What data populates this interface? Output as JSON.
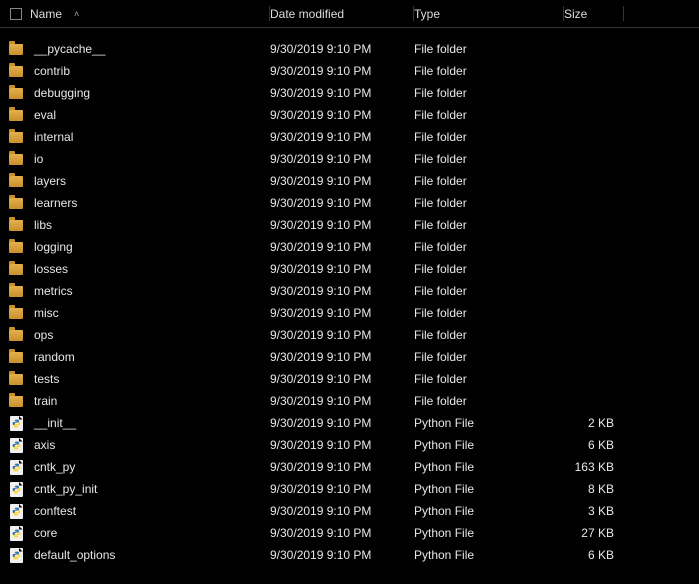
{
  "columns": {
    "name": "Name",
    "date": "Date modified",
    "type": "Type",
    "size": "Size"
  },
  "sort": {
    "column": "name",
    "direction": "asc"
  },
  "types": {
    "folder": "File folder",
    "python": "Python File"
  },
  "items": [
    {
      "name": "__pycache__",
      "date": "9/30/2019 9:10 PM",
      "kind": "folder",
      "size": ""
    },
    {
      "name": "contrib",
      "date": "9/30/2019 9:10 PM",
      "kind": "folder",
      "size": ""
    },
    {
      "name": "debugging",
      "date": "9/30/2019 9:10 PM",
      "kind": "folder",
      "size": ""
    },
    {
      "name": "eval",
      "date": "9/30/2019 9:10 PM",
      "kind": "folder",
      "size": ""
    },
    {
      "name": "internal",
      "date": "9/30/2019 9:10 PM",
      "kind": "folder",
      "size": ""
    },
    {
      "name": "io",
      "date": "9/30/2019 9:10 PM",
      "kind": "folder",
      "size": ""
    },
    {
      "name": "layers",
      "date": "9/30/2019 9:10 PM",
      "kind": "folder",
      "size": ""
    },
    {
      "name": "learners",
      "date": "9/30/2019 9:10 PM",
      "kind": "folder",
      "size": ""
    },
    {
      "name": "libs",
      "date": "9/30/2019 9:10 PM",
      "kind": "folder",
      "size": ""
    },
    {
      "name": "logging",
      "date": "9/30/2019 9:10 PM",
      "kind": "folder",
      "size": ""
    },
    {
      "name": "losses",
      "date": "9/30/2019 9:10 PM",
      "kind": "folder",
      "size": ""
    },
    {
      "name": "metrics",
      "date": "9/30/2019 9:10 PM",
      "kind": "folder",
      "size": ""
    },
    {
      "name": "misc",
      "date": "9/30/2019 9:10 PM",
      "kind": "folder",
      "size": ""
    },
    {
      "name": "ops",
      "date": "9/30/2019 9:10 PM",
      "kind": "folder",
      "size": ""
    },
    {
      "name": "random",
      "date": "9/30/2019 9:10 PM",
      "kind": "folder",
      "size": ""
    },
    {
      "name": "tests",
      "date": "9/30/2019 9:10 PM",
      "kind": "folder",
      "size": ""
    },
    {
      "name": "train",
      "date": "9/30/2019 9:10 PM",
      "kind": "folder",
      "size": ""
    },
    {
      "name": "__init__",
      "date": "9/30/2019 9:10 PM",
      "kind": "python",
      "size": "2 KB"
    },
    {
      "name": "axis",
      "date": "9/30/2019 9:10 PM",
      "kind": "python",
      "size": "6 KB"
    },
    {
      "name": "cntk_py",
      "date": "9/30/2019 9:10 PM",
      "kind": "python",
      "size": "163 KB"
    },
    {
      "name": "cntk_py_init",
      "date": "9/30/2019 9:10 PM",
      "kind": "python",
      "size": "8 KB"
    },
    {
      "name": "conftest",
      "date": "9/30/2019 9:10 PM",
      "kind": "python",
      "size": "3 KB"
    },
    {
      "name": "core",
      "date": "9/30/2019 9:10 PM",
      "kind": "python",
      "size": "27 KB"
    },
    {
      "name": "default_options",
      "date": "9/30/2019 9:10 PM",
      "kind": "python",
      "size": "6 KB"
    }
  ]
}
